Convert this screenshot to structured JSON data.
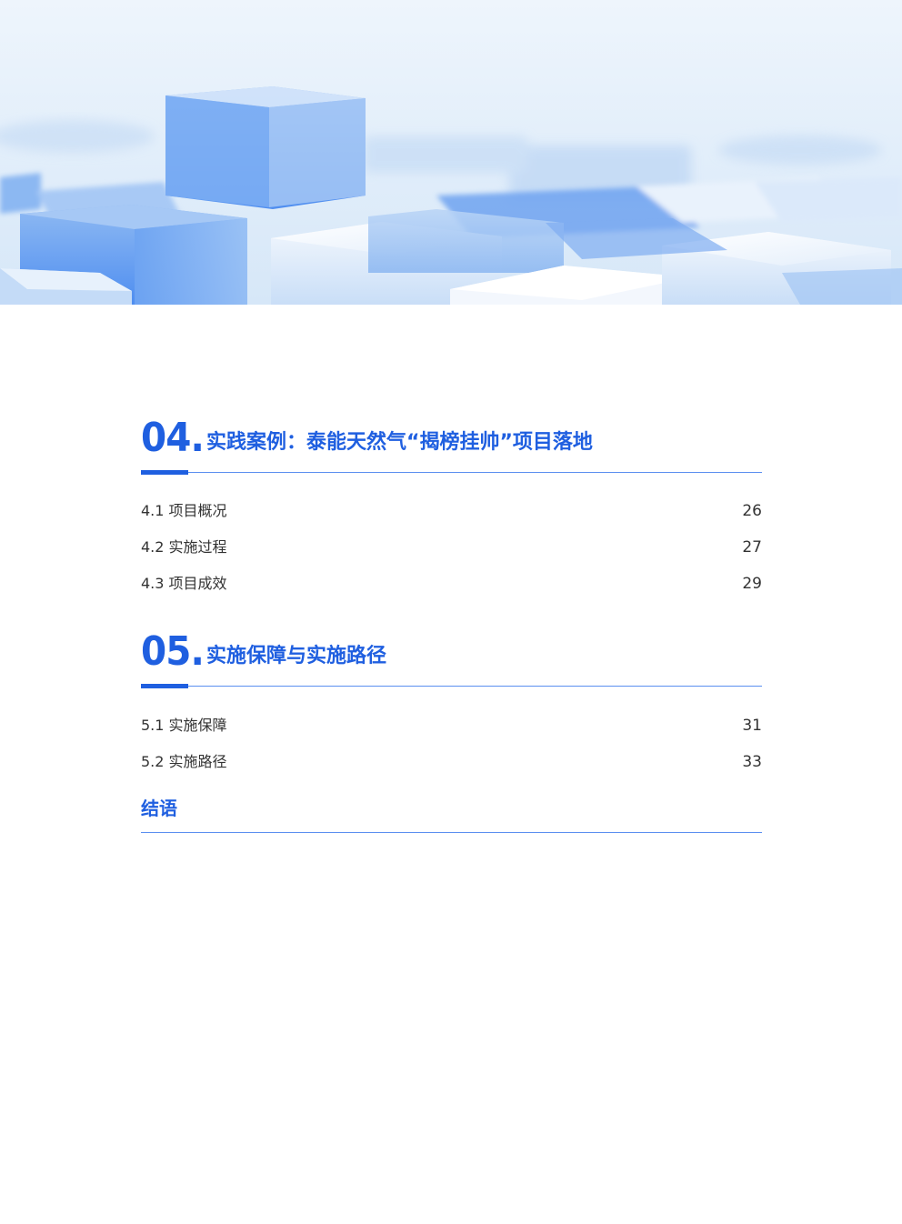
{
  "sections": [
    {
      "number": "04.",
      "title": "实践案例：泰能天然气“揭榜挂帅”项目落地",
      "entries": [
        {
          "label": "4.1 项目概况",
          "page": "26"
        },
        {
          "label": "4.2 实施过程",
          "page": "27"
        },
        {
          "label": "4.3 项目成效",
          "page": "29"
        }
      ]
    },
    {
      "number": "05.",
      "title": "实施保障与实施路径",
      "entries": [
        {
          "label": "5.1 实施保障",
          "page": "31"
        },
        {
          "label": "5.2 实施路径",
          "page": "33"
        }
      ]
    }
  ],
  "conclusion": {
    "title": "结语"
  },
  "colors": {
    "accent": "#1f5fe0",
    "rule": "#5b8ff0",
    "text": "#333333"
  },
  "hero": {
    "description_icon": "glass-cubes-banner"
  }
}
